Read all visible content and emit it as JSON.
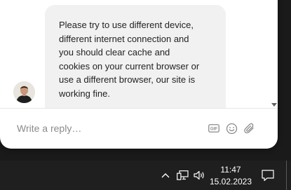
{
  "chat": {
    "message_text": "Please try to use different device,\ndifferent internet connection and\nyou should clear cache and\ncookies on your current browser or\nuse a different browser, our site is\nworking fine.",
    "reply_placeholder": "Write a reply…"
  },
  "icons": {
    "gif": "gif-icon",
    "emoji": "emoji-icon",
    "attach": "paperclip-icon",
    "scroll_down": "chevron-down-icon"
  },
  "taskbar": {
    "time": "11:47",
    "date": "15.02.2023",
    "tray_icons": [
      "chevron-up-icon",
      "network-icon",
      "volume-icon",
      "notification-icon"
    ]
  },
  "colors": {
    "bubble": "#f1f1f2",
    "taskbar": "#1f1f1f",
    "icon_gray": "#8a8a8a"
  }
}
